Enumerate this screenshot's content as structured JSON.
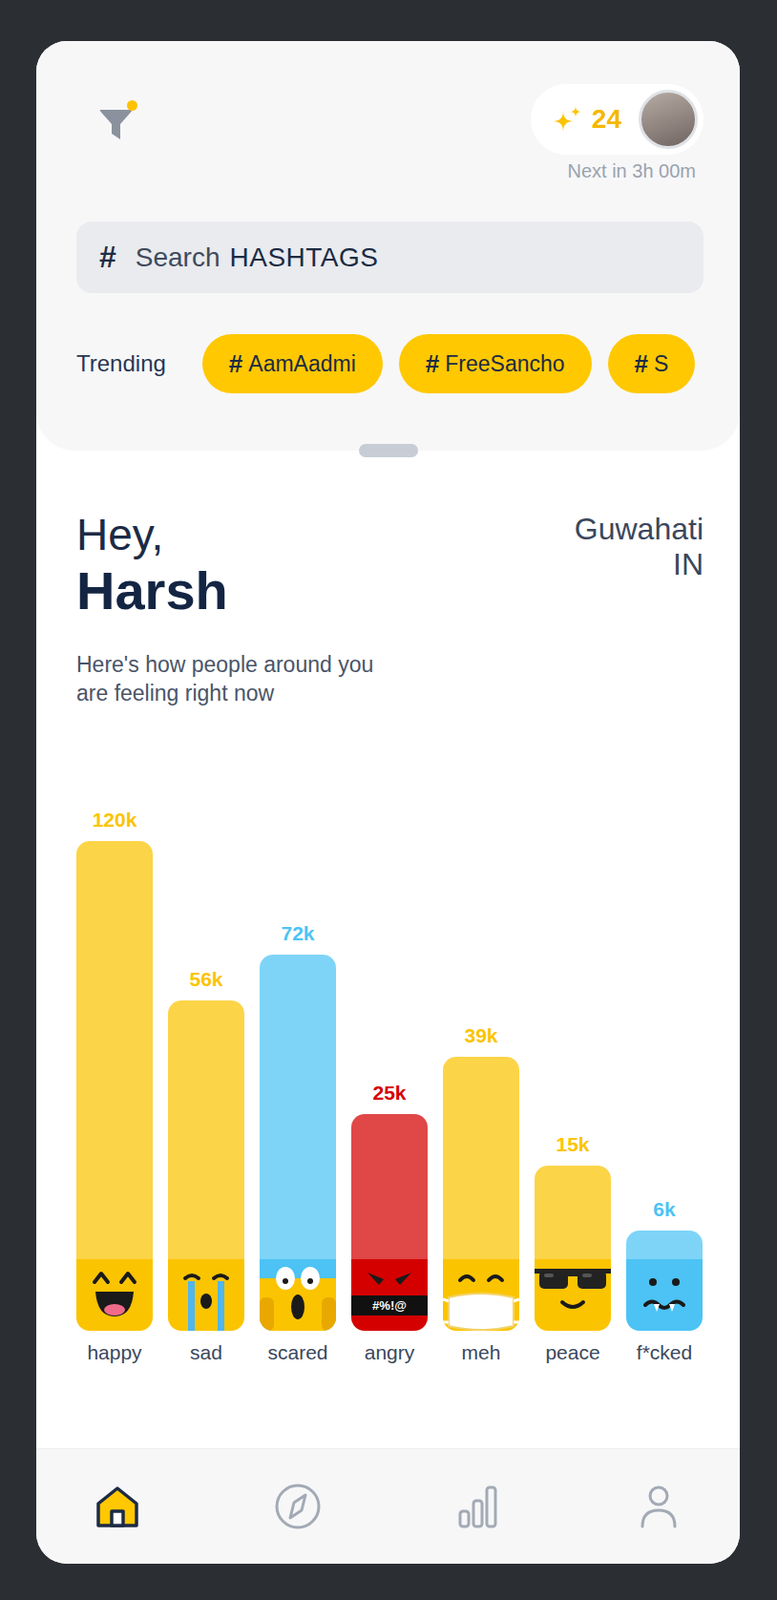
{
  "filter": {
    "active": true
  },
  "credits": {
    "count": "24",
    "next": "Next in 3h 00m"
  },
  "search": {
    "icon": "#",
    "placeholder": "Search",
    "placeholder_emphasis": "HASHTAGS"
  },
  "trending": {
    "label": "Trending",
    "tags": [
      {
        "prefix": "#",
        "label": "AamAadmi"
      },
      {
        "prefix": "#",
        "label": "FreeSancho"
      },
      {
        "prefix": "#",
        "label": "S"
      }
    ]
  },
  "greeting": {
    "salutation": "Hey,",
    "name": "Harsh",
    "city": "Guwahati",
    "country": "IN",
    "subtitle": [
      "Here's how people around you",
      "are feeling right now"
    ]
  },
  "chart": {
    "bars": [
      {
        "label": "happy",
        "value": 120,
        "reading": "120k",
        "color": "#fbc400",
        "kind": "happy"
      },
      {
        "label": "sad",
        "value": 56,
        "reading": "56k",
        "color": "#fbc400",
        "kind": "sad"
      },
      {
        "label": "scared",
        "value": 72,
        "reading": "72k",
        "color": "#4cc3f4",
        "kind": "scared"
      },
      {
        "label": "angry",
        "value": 25,
        "reading": "25k",
        "color": "#d40000",
        "kind": "angry",
        "mark": "#%!@"
      },
      {
        "label": "meh",
        "value": 39,
        "reading": "39k",
        "color": "#fbc400",
        "kind": "meh"
      },
      {
        "label": "peace",
        "value": 15,
        "reading": "15k",
        "color": "#fbc400",
        "kind": "peace"
      },
      {
        "label": "f*cked",
        "value": 6,
        "reading": "6k",
        "color": "#4cc3f4",
        "kind": "sick"
      }
    ]
  },
  "nav": [
    {
      "kind": "home",
      "selected": true
    },
    {
      "kind": "explore",
      "selected": false
    },
    {
      "kind": "stats",
      "selected": false
    },
    {
      "kind": "profile",
      "selected": false
    }
  ]
}
